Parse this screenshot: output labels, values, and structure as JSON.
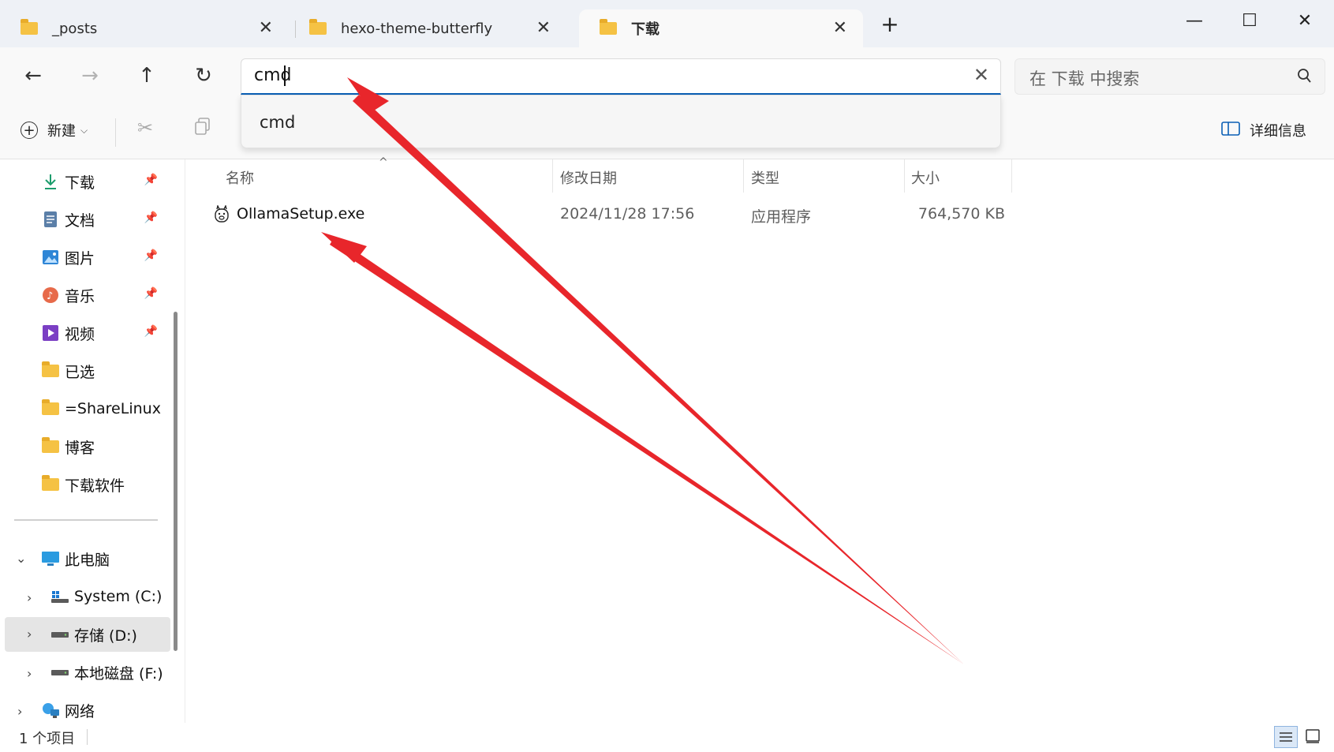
{
  "tabs": [
    {
      "label": "_posts",
      "active": false
    },
    {
      "label": "hexo-theme-butterfly",
      "active": false
    },
    {
      "label": "下载",
      "active": true
    }
  ],
  "window_controls": {
    "minimize": "—",
    "maximize": "☐",
    "close": "✕"
  },
  "address": {
    "value": "cmd",
    "suggestion": "cmd"
  },
  "search": {
    "placeholder": "在 下载 中搜索"
  },
  "toolbar": {
    "new_label": "新建",
    "details_label": "详细信息"
  },
  "sidebar": {
    "quick_access": [
      {
        "label": "下载",
        "icon": "download-icon",
        "pinned": true
      },
      {
        "label": "文档",
        "icon": "document-icon",
        "pinned": true
      },
      {
        "label": "图片",
        "icon": "pictures-icon",
        "pinned": true
      },
      {
        "label": "音乐",
        "icon": "music-icon",
        "pinned": true
      },
      {
        "label": "视频",
        "icon": "video-icon",
        "pinned": true
      },
      {
        "label": "已选",
        "icon": "folder-icon",
        "pinned": false
      },
      {
        "label": "=ShareLinux",
        "icon": "folder-icon",
        "pinned": false
      },
      {
        "label": "博客",
        "icon": "folder-icon",
        "pinned": false
      },
      {
        "label": "下载软件",
        "icon": "folder-icon",
        "pinned": false
      }
    ],
    "this_pc": "此电脑",
    "drives": [
      {
        "label": "System (C:)",
        "icon": "system-drive-icon",
        "selected": false
      },
      {
        "label": "存储 (D:)",
        "icon": "drive-icon",
        "selected": true
      },
      {
        "label": "本地磁盘 (F:)",
        "icon": "drive-icon",
        "selected": false
      }
    ],
    "network": "网络"
  },
  "columns": [
    "名称",
    "修改日期",
    "类型",
    "大小"
  ],
  "files": [
    {
      "name": "OllamaSetup.exe",
      "modified": "2024/11/28 17:56",
      "type": "应用程序",
      "size": "764,570 KB"
    }
  ],
  "status": {
    "item_count": "1 个项目"
  },
  "colors": {
    "accent": "#0a5fb5",
    "annotation_arrow": "#e8262b",
    "folder": "#f5c244"
  }
}
